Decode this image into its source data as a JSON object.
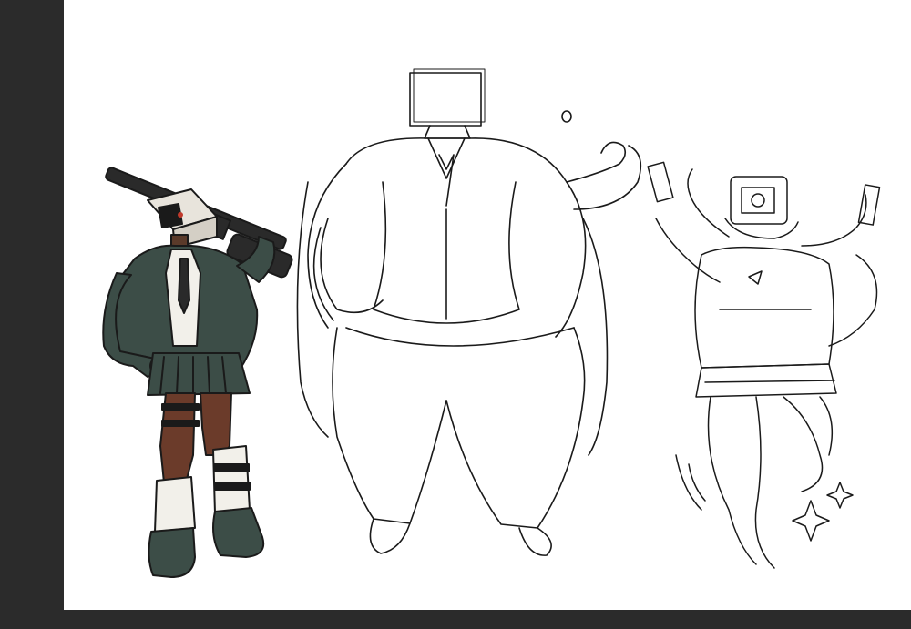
{
  "window": {
    "background": "#2b2b2b",
    "canvas_color": "#ffffff"
  },
  "artwork": {
    "figures": [
      {
        "name": "colored-character-with-rifle",
        "style": "colored"
      },
      {
        "name": "large-sketch-character-in-suit",
        "style": "sketch"
      },
      {
        "name": "sketch-character-with-pistols",
        "style": "sketch"
      }
    ],
    "palette": {
      "jacket": "#3c4d47",
      "skin": "#5a3a2a",
      "tights": "#6b3b2a",
      "shirt": "#f2f0ea",
      "monitor": "#e8e4dc",
      "line": "#1a1a1a",
      "accent": "#c0392b"
    }
  }
}
